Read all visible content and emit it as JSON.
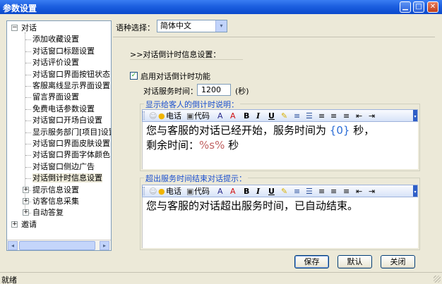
{
  "window": {
    "title": "参数设置",
    "min": "▁",
    "max": "□",
    "close": "✕"
  },
  "tree": {
    "root": {
      "label": "对话",
      "expander": "−"
    },
    "children": [
      "添加收藏设置",
      "对话窗口标题设置",
      "对话评价设置",
      "对话窗口界面按钮状态",
      "客服离线显示界面设置",
      "留言界面设置",
      "免费电话参数设置",
      "对话窗口开场白设置",
      "显示服务部门[项目]设置",
      "对话窗口界面皮肤设置",
      "对话窗口界面字体颜色",
      "对话窗口侧边广告",
      "对话倒计时信息设置"
    ],
    "selected_index": 12,
    "siblings": [
      {
        "label": "提示信息设置",
        "expander": "+"
      },
      {
        "label": "访客信息采集",
        "expander": "+"
      },
      {
        "label": "自动答复",
        "expander": "+"
      }
    ],
    "root2": {
      "label": "邀请",
      "expander": "+"
    },
    "scroll_left": "◂",
    "scroll_right": "▸"
  },
  "language": {
    "label": "语种选择：",
    "value": "简体中文",
    "arrow": "▾"
  },
  "section_title": ">>对话倒计时信息设置：",
  "enable": {
    "checked": true,
    "check_mark": "✓",
    "label": "启用对话倒计时功能"
  },
  "service_time": {
    "label": "对话服务时间：",
    "value": "1200",
    "unit": "(秒)"
  },
  "toolbar": {
    "phone": "电话",
    "code": "代码",
    "bold": "B",
    "italic": "I",
    "underline": "U",
    "font_icon": "A",
    "color_icon": "A"
  },
  "countdown_box": {
    "legend": "显示给客人的倒计时说明：",
    "line1_prefix": "您与客服的对话已经开始，服务时间为 ",
    "line1_var": "{0}",
    "line1_suffix": " 秒，",
    "line2_prefix": "剩余时间：",
    "line2_var": "%s%",
    "line2_suffix": " 秒"
  },
  "timeout_box": {
    "legend": "超出服务时间结束对话提示：",
    "text": "您与客服的对话超出服务时间，已自动结束。"
  },
  "buttons": {
    "save": "保存",
    "default": "默认",
    "close": "关闭"
  },
  "status": {
    "text": "就绪"
  },
  "colors": {
    "title_bar": "#0a49cc",
    "legend": "#1a4fcf",
    "variable": "#2a6cd6"
  }
}
